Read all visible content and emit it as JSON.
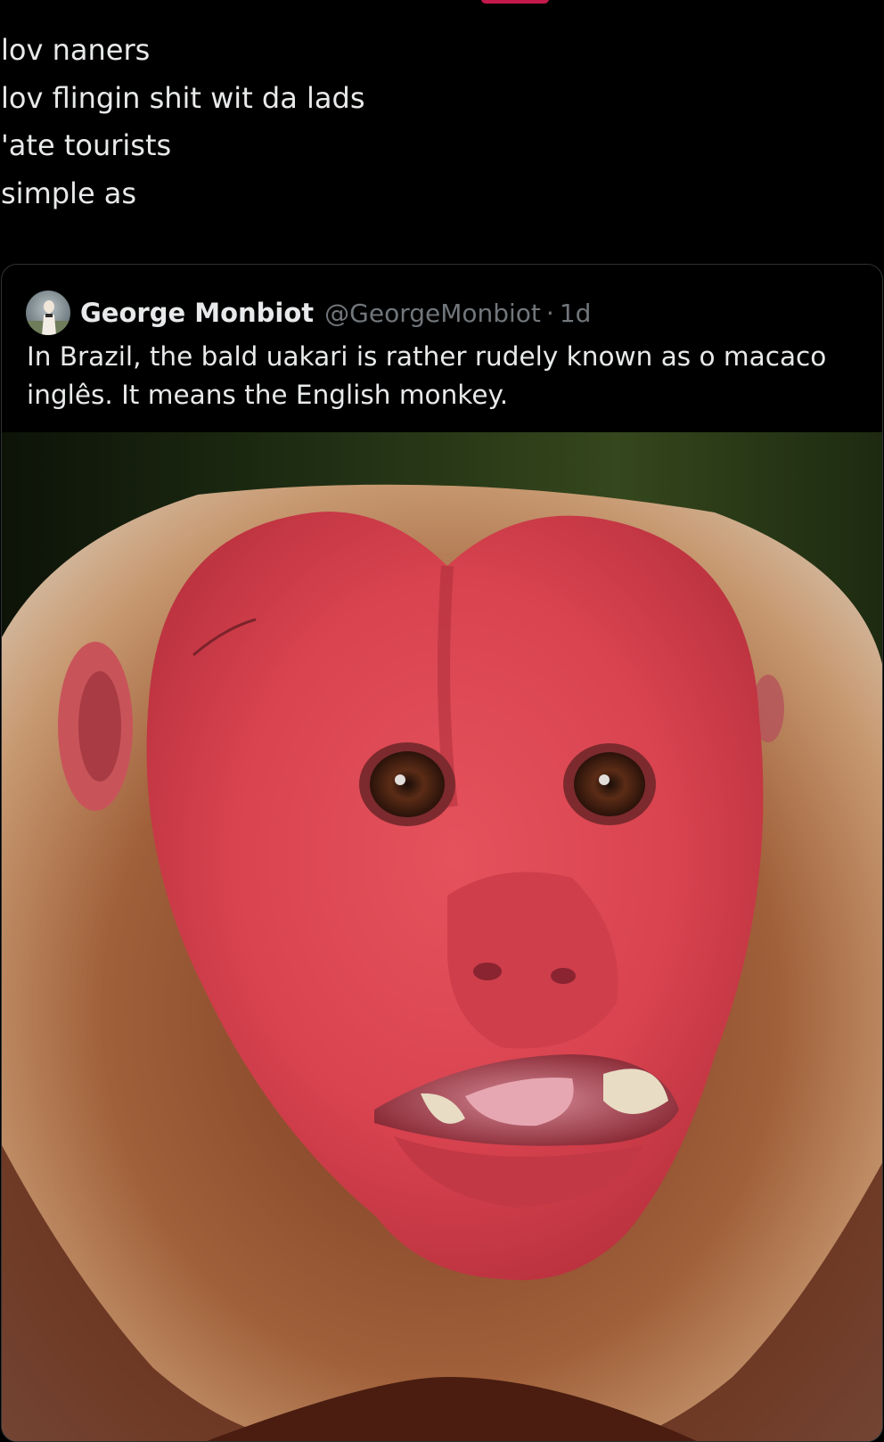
{
  "post": {
    "lines": [
      "lov naners",
      "lov flingin shit wit da lads",
      "'ate tourists",
      "simple as"
    ]
  },
  "quoted_post": {
    "author_name": "George Monbiot",
    "author_handle": "@GeorgeMonbiot",
    "separator": "·",
    "age": "1d",
    "text": "In Brazil, the bald uakari is rather rudely known as o macaco inglês. It means the English monkey.",
    "media": {
      "alt": "Close-up photo of a bald uakari monkey with a bright red face and brown eyes"
    }
  },
  "colors": {
    "background": "#000000",
    "text": "#e7e9ea",
    "secondary_text": "#71767b",
    "border": "#2f3336",
    "accent": "#c21a4c"
  }
}
